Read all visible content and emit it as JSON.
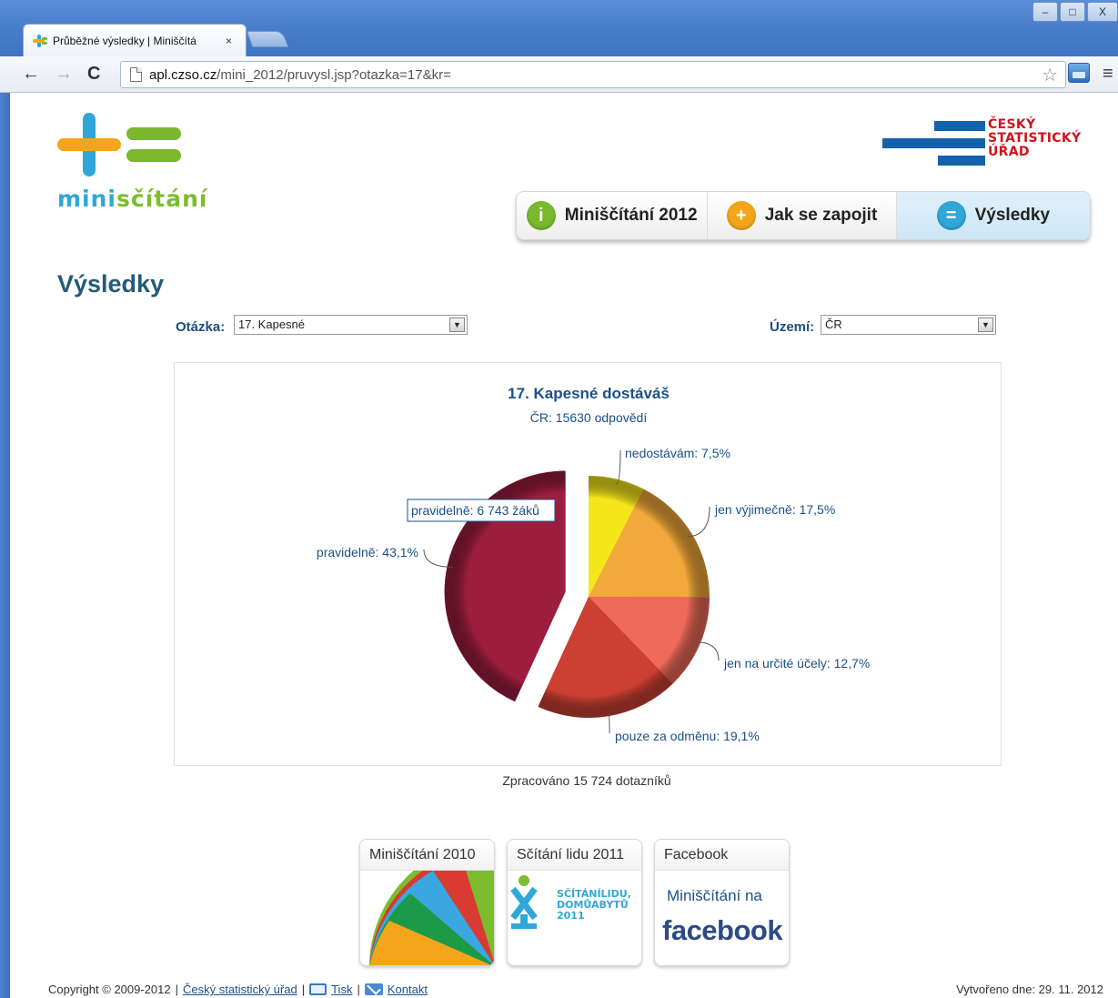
{
  "browser": {
    "tab_title": "Průběžné výsledky | Miniščítá",
    "tab_close": "×",
    "url_host": "apl.czso.cz",
    "url_path": "/mini_2012/pruvysl.jsp?otazka=17&kr=",
    "window_controls": [
      "–",
      "□",
      "X"
    ]
  },
  "header": {
    "logo_text_a": "mini",
    "logo_text_b": "sčítání",
    "csu_logo": [
      "ČESKÝ",
      "STATISTICKÝ",
      "ÚŘAD"
    ]
  },
  "nav": {
    "items": [
      {
        "label": "Miniščítání 2012",
        "icon": "info-icon",
        "symbol": "i",
        "color": "#7ab82d"
      },
      {
        "label": "Jak se zapojit",
        "icon": "plus-icon",
        "symbol": "+",
        "color": "#f4a51c"
      },
      {
        "label": "Výsledky",
        "icon": "equals-icon",
        "symbol": "=",
        "color": "#30a7d8"
      }
    ]
  },
  "page": {
    "title": "Výsledky",
    "question_label": "Otázka:",
    "question_value": "17. Kapesné",
    "region_label": "Území:",
    "region_value": "ČR",
    "processed": "Zpracováno 15 724 dotazníků"
  },
  "chart_data": {
    "type": "pie",
    "title": "17. Kapesné dostáváš",
    "subtitle": "ČR: 15630 odpovědí",
    "tooltip": "pravidelně: 6 743 žáků",
    "slices": [
      {
        "name": "nedostávám",
        "value": 7.5,
        "label": "nedostávám: 7,5%",
        "color": "#f5e61a"
      },
      {
        "name": "jen výjimečně",
        "value": 17.5,
        "label": "jen výjimečně: 17,5%",
        "color": "#f2a93b"
      },
      {
        "name": "jen na určité účely",
        "value": 12.7,
        "label": "jen na určité účely: 12,7%",
        "color": "#ee6a5a"
      },
      {
        "name": "pouze za odměnu",
        "value": 19.1,
        "label": "pouze za odměnu: 19,1%",
        "color": "#cc4033"
      },
      {
        "name": "pravidelně",
        "value": 43.1,
        "label": "pravidelně: 43,1%",
        "color": "#9c1d3e"
      }
    ]
  },
  "promos": [
    {
      "title": "Miniščítání 2010"
    },
    {
      "title": "Sčítání lidu 2011",
      "logo_lines": [
        "SČÍTÁNÍLIDU,",
        "DOMŮABYTŮ",
        "2011"
      ]
    },
    {
      "title": "Facebook",
      "text_small": "Miniščítání na",
      "text_big": "facebook"
    }
  ],
  "footer": {
    "copyright": "Copyright © 2009-2012",
    "sep": "|",
    "link_csu": "Český statistický úřad",
    "link_print": "Tisk",
    "link_contact": "Kontakt",
    "created": "Vytvořeno dne: 29. 11. 2012"
  }
}
